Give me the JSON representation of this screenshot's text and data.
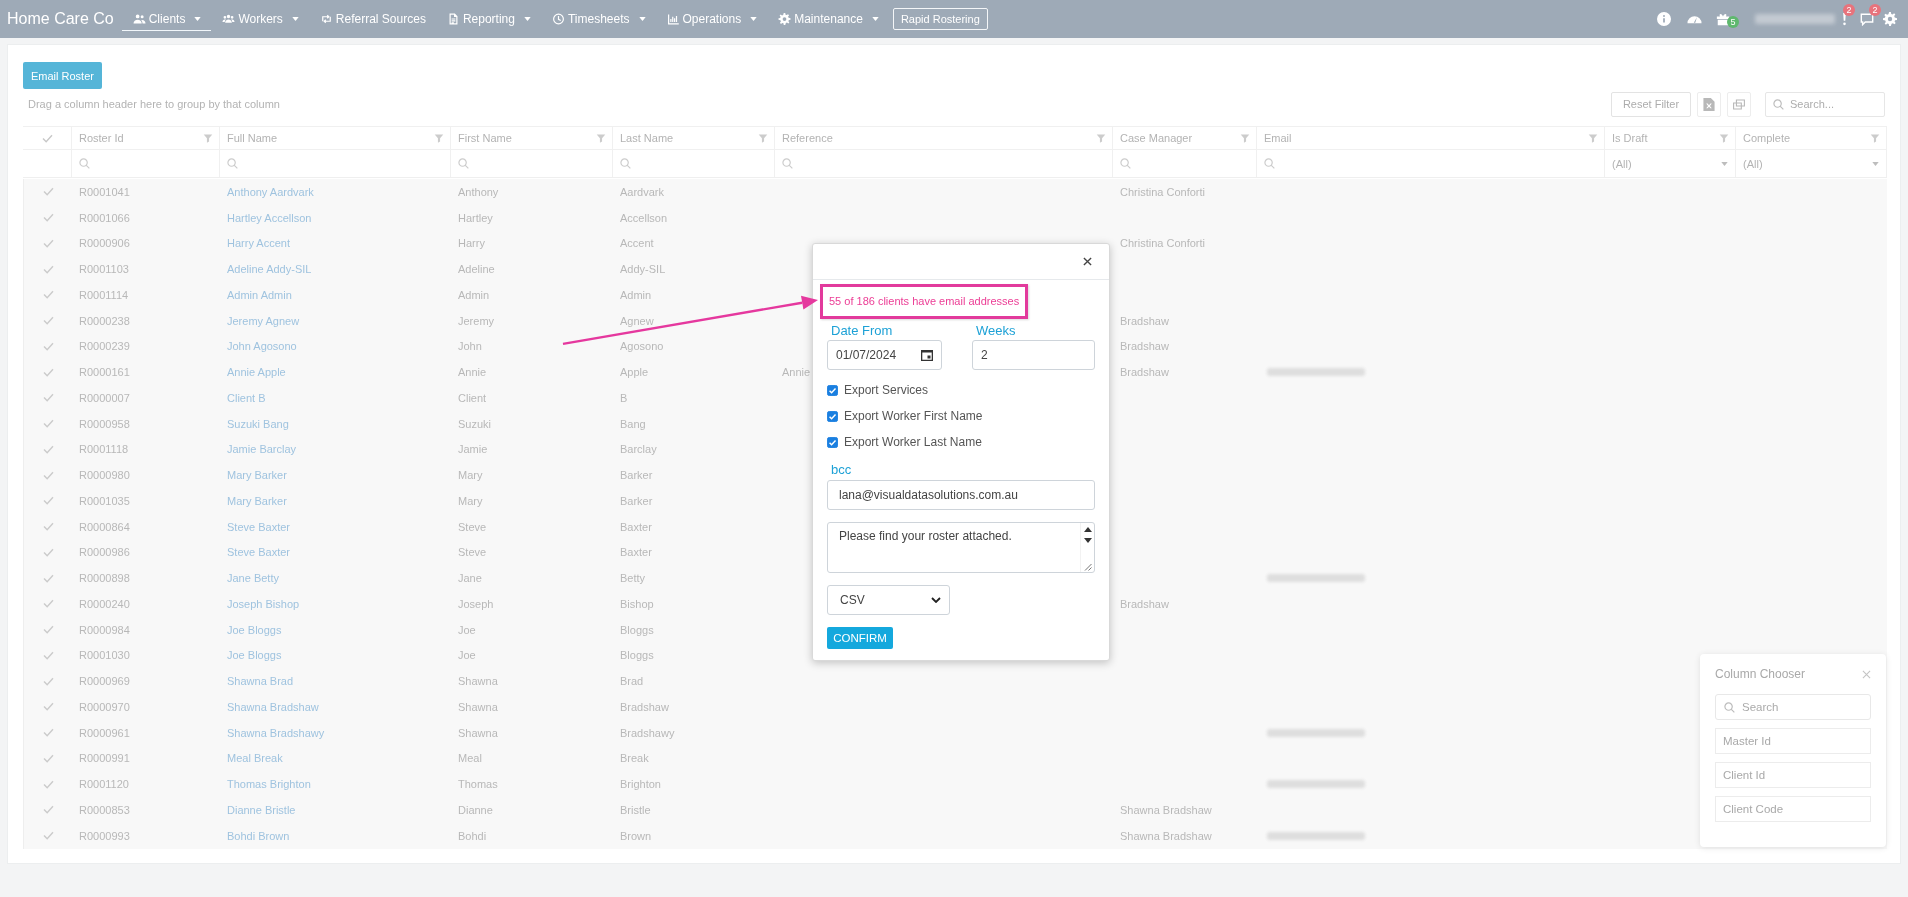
{
  "nav": {
    "brand": "Home Care Co",
    "items": [
      {
        "label": "Clients",
        "dropdown": true,
        "selected": true
      },
      {
        "label": "Workers",
        "dropdown": true,
        "selected": false
      },
      {
        "label": "Referral Sources",
        "dropdown": false,
        "selected": false
      },
      {
        "label": "Reporting",
        "dropdown": true,
        "selected": false
      },
      {
        "label": "Timesheets",
        "dropdown": true,
        "selected": false
      },
      {
        "label": "Operations",
        "dropdown": true,
        "selected": false
      },
      {
        "label": "Maintenance",
        "dropdown": true,
        "selected": false
      }
    ],
    "rapid_button": "Rapid Rostering",
    "gift_badge": "5",
    "user_name_redacted": true,
    "alert_badge": "2",
    "message_badge": "2"
  },
  "toolbar": {
    "email_button": "Email Roster",
    "group_hint": "Drag a column header here to group by that column",
    "reset_filter": "Reset Filter",
    "search_placeholder": "Search..."
  },
  "table": {
    "select_all_checked": true,
    "columns": [
      {
        "title": "Roster Id",
        "kind": "search"
      },
      {
        "title": "Full Name",
        "kind": "search"
      },
      {
        "title": "First Name",
        "kind": "search"
      },
      {
        "title": "Last Name",
        "kind": "search"
      },
      {
        "title": "Reference",
        "kind": "search"
      },
      {
        "title": "Case Manager",
        "kind": "search"
      },
      {
        "title": "Email",
        "kind": "search"
      },
      {
        "title": "Is Draft",
        "kind": "select",
        "filter_value": "(All)"
      },
      {
        "title": "Complete",
        "kind": "select",
        "filter_value": "(All)"
      }
    ],
    "rows": [
      {
        "checked": true,
        "roster_id": "R0001041",
        "full_name": "Anthony Aardvark",
        "first_name": "Anthony",
        "last_name": "Aardvark",
        "case_manager": "Christina Conforti",
        "email_redacted": false
      },
      {
        "checked": true,
        "roster_id": "R0001066",
        "full_name": "Hartley Accellson",
        "first_name": "Hartley",
        "last_name": "Accellson",
        "email_redacted": false
      },
      {
        "checked": true,
        "roster_id": "R0000906",
        "full_name": "Harry Accent",
        "first_name": "Harry",
        "last_name": "Accent",
        "case_manager": "Christina Conforti",
        "email_redacted": false
      },
      {
        "checked": true,
        "roster_id": "R0001103",
        "full_name": "Adeline Addy-SIL",
        "first_name": "Adeline",
        "last_name": "Addy-SIL",
        "email_redacted": false
      },
      {
        "checked": true,
        "roster_id": "R0001114",
        "full_name": "Admin Admin",
        "first_name": "Admin",
        "last_name": "Admin",
        "email_redacted": false
      },
      {
        "checked": true,
        "roster_id": "R0000238",
        "full_name": "Jeremy Agnew",
        "first_name": "Jeremy",
        "last_name": "Agnew",
        "case_manager": "Bradshaw",
        "email_redacted": false
      },
      {
        "checked": true,
        "roster_id": "R0000239",
        "full_name": "John Agosono",
        "first_name": "John",
        "last_name": "Agosono",
        "case_manager": "Bradshaw",
        "email_redacted": false
      },
      {
        "checked": true,
        "roster_id": "R0000161",
        "full_name": "Annie Apple",
        "first_name": "Annie",
        "last_name": "Apple",
        "reference": "Annie",
        "case_manager": "Bradshaw",
        "email_redacted": true
      },
      {
        "checked": true,
        "roster_id": "R0000007",
        "full_name": "Client B",
        "first_name": "Client",
        "last_name": "B",
        "email_redacted": false
      },
      {
        "checked": true,
        "roster_id": "R0000958",
        "full_name": "Suzuki Bang",
        "first_name": "Suzuki",
        "last_name": "Bang",
        "email_redacted": false
      },
      {
        "checked": true,
        "roster_id": "R0001118",
        "full_name": "Jamie Barclay",
        "first_name": "Jamie",
        "last_name": "Barclay",
        "email_redacted": false
      },
      {
        "checked": true,
        "roster_id": "R0000980",
        "full_name": "Mary Barker",
        "first_name": "Mary",
        "last_name": "Barker",
        "email_redacted": false
      },
      {
        "checked": true,
        "roster_id": "R0001035",
        "full_name": "Mary Barker",
        "first_name": "Mary",
        "last_name": "Barker",
        "email_redacted": false
      },
      {
        "checked": true,
        "roster_id": "R0000864",
        "full_name": "Steve Baxter",
        "first_name": "Steve",
        "last_name": "Baxter",
        "email_redacted": false
      },
      {
        "checked": true,
        "roster_id": "R0000986",
        "full_name": "Steve Baxter",
        "first_name": "Steve",
        "last_name": "Baxter",
        "email_redacted": false
      },
      {
        "checked": true,
        "roster_id": "R0000898",
        "full_name": "Jane Betty",
        "first_name": "Jane",
        "last_name": "Betty",
        "email_redacted": true
      },
      {
        "checked": true,
        "roster_id": "R0000240",
        "full_name": "Joseph Bishop",
        "first_name": "Joseph",
        "last_name": "Bishop",
        "case_manager": "Bradshaw",
        "email_redacted": false
      },
      {
        "checked": true,
        "roster_id": "R0000984",
        "full_name": "Joe Bloggs",
        "first_name": "Joe",
        "last_name": "Bloggs",
        "email_redacted": false
      },
      {
        "checked": true,
        "roster_id": "R0001030",
        "full_name": "Joe Bloggs",
        "first_name": "Joe",
        "last_name": "Bloggs",
        "email_redacted": false
      },
      {
        "checked": true,
        "roster_id": "R0000969",
        "full_name": "Shawna Brad",
        "first_name": "Shawna",
        "last_name": "Brad",
        "email_redacted": false
      },
      {
        "checked": true,
        "roster_id": "R0000970",
        "full_name": "Shawna Bradshaw",
        "first_name": "Shawna",
        "last_name": "Bradshaw",
        "email_redacted": false
      },
      {
        "checked": true,
        "roster_id": "R0000961",
        "full_name": "Shawna Bradshawy",
        "first_name": "Shawna",
        "last_name": "Bradshawy",
        "email_redacted": true
      },
      {
        "checked": true,
        "roster_id": "R0000991",
        "full_name": "Meal Break",
        "first_name": "Meal",
        "last_name": "Break",
        "email_redacted": false
      },
      {
        "checked": true,
        "roster_id": "R0001120",
        "full_name": "Thomas Brighton",
        "first_name": "Thomas",
        "last_name": "Brighton",
        "email_redacted": true
      },
      {
        "checked": true,
        "roster_id": "R0000853",
        "full_name": "Dianne Bristle",
        "first_name": "Dianne",
        "last_name": "Bristle",
        "case_manager": "Shawna Bradshaw",
        "email_redacted": false
      },
      {
        "checked": true,
        "roster_id": "R0000993",
        "full_name": "Bohdi Brown",
        "first_name": "Bohdi",
        "last_name": "Brown",
        "case_manager": "Shawna Bradshaw",
        "email_redacted": true
      }
    ]
  },
  "dialog": {
    "notice": "55 of 186 clients have email addresses",
    "notice_highlighted": true,
    "date_from": {
      "label": "Date From",
      "value": "01/07/2024"
    },
    "weeks": {
      "label": "Weeks",
      "value": "2"
    },
    "options": [
      {
        "label": "Export Services",
        "checked": true
      },
      {
        "label": "Export Worker First Name",
        "checked": true
      },
      {
        "label": "Export Worker Last Name",
        "checked": true
      }
    ],
    "bcc": {
      "label": "bcc",
      "value": "lana@visualdatasolutions.com.au"
    },
    "message": "Please find your roster attached.",
    "format": "CSV",
    "confirm_button": "CONFIRM"
  },
  "annotation_arrow": true,
  "column_chooser": {
    "title": "Column Chooser",
    "search_placeholder": "Search",
    "items": [
      "Master Id",
      "Client Id",
      "Client Code"
    ]
  }
}
